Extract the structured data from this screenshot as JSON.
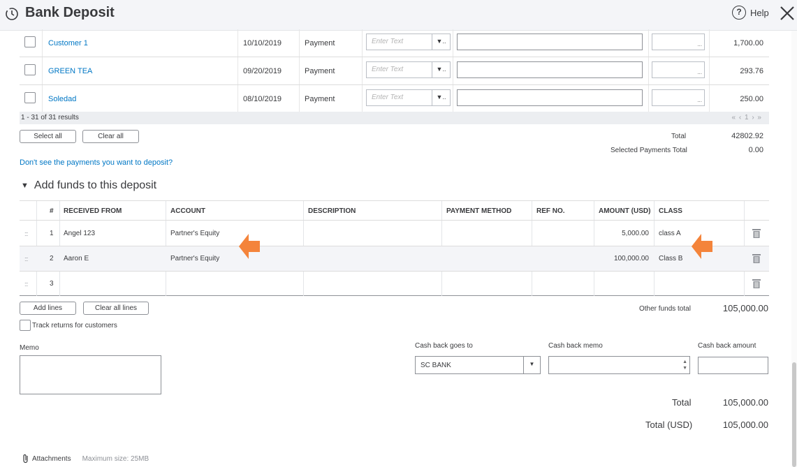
{
  "header": {
    "title": "Bank Deposit",
    "help_label": "Help",
    "help_symbol": "?"
  },
  "payments": {
    "enter_text_placeholder": "Enter Text",
    "rows": [
      {
        "name": "Customer 1",
        "date": "10/10/2019",
        "type": "Payment",
        "amount": "1,700.00"
      },
      {
        "name": "GREEN TEA",
        "date": "09/20/2019",
        "type": "Payment",
        "amount": "293.76"
      },
      {
        "name": "Soledad",
        "date": "08/10/2019",
        "type": "Payment",
        "amount": "250.00"
      }
    ],
    "results_text": "1 - 31 of 31 results",
    "pager": "« ‹ 1 › »",
    "select_all_label": "Select all",
    "clear_all_label": "Clear all",
    "total_label": "Total",
    "total_value": "42802.92",
    "selected_total_label": "Selected Payments Total",
    "selected_total_value": "0.00",
    "missing_link": "Don't see the payments you want to deposit?"
  },
  "funds": {
    "section_title": "Add funds to this deposit",
    "headers": {
      "num": "#",
      "received_from": "RECEIVED FROM",
      "account": "ACCOUNT",
      "description": "DESCRIPTION",
      "payment_method": "PAYMENT METHOD",
      "ref_no": "REF NO.",
      "amount": "AMOUNT (USD)",
      "class": "CLASS"
    },
    "rows": [
      {
        "num": "1",
        "received_from": "Angel 123",
        "account": "Partner's Equity",
        "amount": "5,000.00",
        "class": "class A"
      },
      {
        "num": "2",
        "received_from": "Aaron E",
        "account": "Partner's Equity",
        "amount": "100,000.00",
        "class": "Class B"
      },
      {
        "num": "3",
        "received_from": "",
        "account": "",
        "amount": "",
        "class": ""
      }
    ],
    "add_lines_label": "Add lines",
    "clear_all_lines_label": "Clear all lines",
    "other_funds_total_label": "Other funds total",
    "other_funds_total_value": "105,000.00",
    "track_returns_label": "Track returns for customers",
    "arrow_color": "#f4843b"
  },
  "bottom": {
    "memo_label": "Memo",
    "cash_back_goes_to_label": "Cash back goes to",
    "cash_back_goes_to_value": "SC BANK",
    "cash_back_memo_label": "Cash back memo",
    "cash_back_amount_label": "Cash back amount",
    "total_label": "Total",
    "total_value": "105,000.00",
    "total_usd_label": "Total (USD)",
    "total_usd_value": "105,000.00",
    "attachments_label": "Attachments",
    "max_size": "Maximum size: 25MB"
  }
}
